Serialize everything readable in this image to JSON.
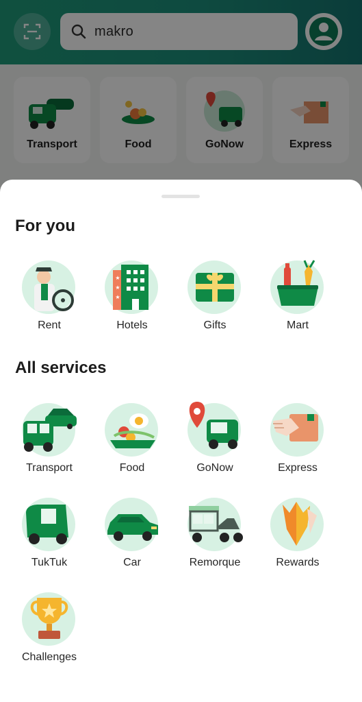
{
  "search": {
    "value": "makro"
  },
  "quick_actions": [
    {
      "label": "Transport",
      "icon": "transport-icon"
    },
    {
      "label": "Food",
      "icon": "food-icon"
    },
    {
      "label": "GoNow",
      "icon": "gonow-icon"
    },
    {
      "label": "Express",
      "icon": "express-icon"
    }
  ],
  "for_you": {
    "title": "For you",
    "items": [
      {
        "label": "Rent",
        "icon": "rent-icon"
      },
      {
        "label": "Hotels",
        "icon": "hotels-icon"
      },
      {
        "label": "Gifts",
        "icon": "gifts-icon"
      },
      {
        "label": "Mart",
        "icon": "mart-icon"
      }
    ]
  },
  "all_services": {
    "title": "All services",
    "items": [
      {
        "label": "Transport",
        "icon": "transport-icon"
      },
      {
        "label": "Food",
        "icon": "food-icon"
      },
      {
        "label": "GoNow",
        "icon": "gonow-icon"
      },
      {
        "label": "Express",
        "icon": "express-icon"
      },
      {
        "label": "TukTuk",
        "icon": "tuktuk-icon"
      },
      {
        "label": "Car",
        "icon": "car-icon"
      },
      {
        "label": "Remorque",
        "icon": "remorque-icon"
      },
      {
        "label": "Rewards",
        "icon": "rewards-icon"
      },
      {
        "label": "Challenges",
        "icon": "challenges-icon"
      }
    ]
  },
  "colors": {
    "header_green": "#1f9a7a",
    "icon_circle": "#d7f1e3",
    "brand_green": "#00a15a",
    "dark_green": "#0b6b3a"
  }
}
